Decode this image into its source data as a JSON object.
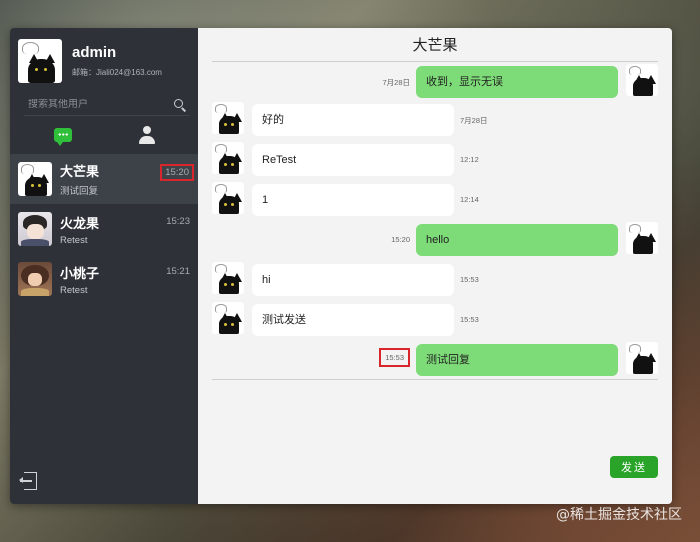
{
  "profile": {
    "name": "admin",
    "email": "邮箱：Jiali024@163.com"
  },
  "search": {
    "placeholder": "搜索其他用户"
  },
  "tabs": {
    "chat_icon": "chat-bubble-icon",
    "contacts_icon": "user-icon"
  },
  "conversations": [
    {
      "name": "大芒果",
      "preview": "测试回复",
      "time": "15:20",
      "active": true,
      "highlighted_time": true
    },
    {
      "name": "火龙果",
      "preview": "Retest",
      "time": "15:23"
    },
    {
      "name": "小桃子",
      "preview": "Retest",
      "time": "15:21"
    }
  ],
  "chat": {
    "title": "大芒果",
    "messages": [
      {
        "direction": "out",
        "text": "收到，显示无误",
        "time": "7月28日"
      },
      {
        "direction": "in",
        "text": "好的",
        "time": "7月28日"
      },
      {
        "direction": "in",
        "text": "ReTest",
        "time": "12:12"
      },
      {
        "direction": "in",
        "text": "1",
        "time": "12:14"
      },
      {
        "direction": "out",
        "text": "hello",
        "time": "15:20"
      },
      {
        "direction": "in",
        "text": "hi",
        "time": "15:53"
      },
      {
        "direction": "in",
        "text": "测试发送",
        "time": "15:53"
      },
      {
        "direction": "out",
        "text": "测试回复",
        "time": "15:53",
        "highlighted_time": true
      }
    ],
    "send_label": "发送"
  },
  "watermark": "@稀土掘金技术社区",
  "colors": {
    "sidebar_bg": "#2e3238",
    "active_item_bg": "#3d4249",
    "outgoing_bubble": "#7ddc78",
    "incoming_bubble": "#ffffff",
    "send_button": "#29a429",
    "accent_tab": "#2fbf3a",
    "highlight_box": "#d8262c"
  }
}
